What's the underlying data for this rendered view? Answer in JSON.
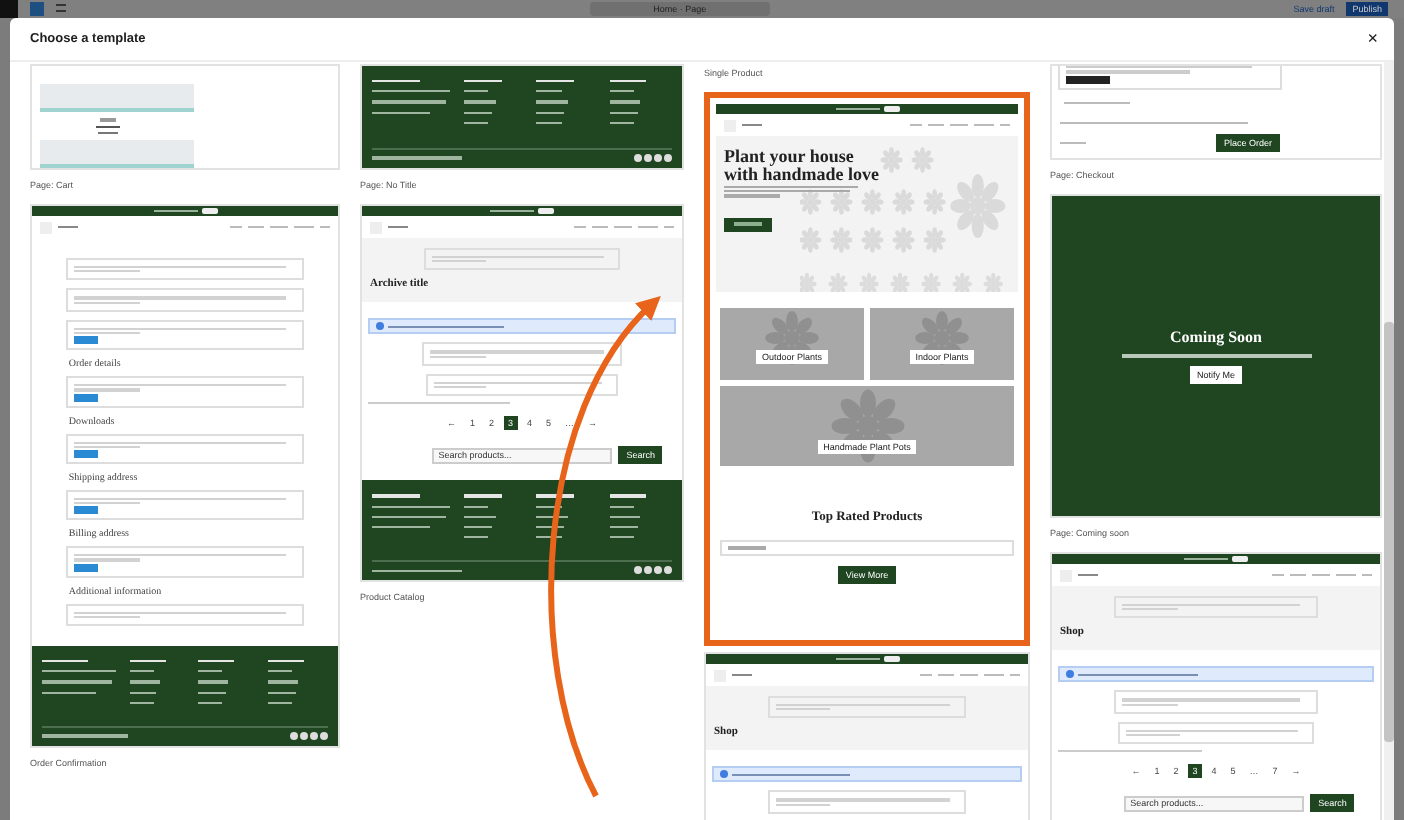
{
  "toolbar": {
    "document": "Home · Page",
    "save": "Save draft",
    "publish": "Publish"
  },
  "modal": {
    "title": "Choose a template",
    "close": "×"
  },
  "columns": [
    {
      "items": [
        {
          "kind": "cart",
          "label": "Page: Cart",
          "selected": false
        },
        {
          "kind": "order",
          "label": "Order Confirmation",
          "selected": false,
          "sections": [
            "Order details",
            "Downloads",
            "Shipping address",
            "Billing address",
            "Additional information"
          ]
        }
      ]
    },
    {
      "items": [
        {
          "kind": "footer",
          "label": "Page: No Title",
          "selected": false
        },
        {
          "kind": "archive",
          "label": "Product Catalog",
          "selected": false,
          "title": "Archive title",
          "pages": [
            {
              "label": "←",
              "selected": false
            },
            {
              "label": "1",
              "selected": false
            },
            {
              "label": "2",
              "selected": false
            },
            {
              "label": "3",
              "selected": true
            },
            {
              "label": "4",
              "selected": false
            },
            {
              "label": "5",
              "selected": false
            },
            {
              "label": "…",
              "selected": false
            },
            {
              "label": "→",
              "selected": false
            }
          ],
          "search": {
            "placeholder": "Search products...",
            "button": "Search"
          },
          "footer": true
        }
      ]
    },
    {
      "items": [
        {
          "kind": "caption",
          "label": "Single Product"
        },
        {
          "kind": "product",
          "selected": true,
          "headline": "Plant your house with handmade love",
          "tiles": [
            "Outdoor Plants",
            "Indoor Plants",
            "Handmade Plant Pots"
          ],
          "section_title": "Top Rated Products",
          "button": "View More"
        },
        {
          "kind": "archive",
          "selected": false,
          "title": "Shop"
        }
      ]
    },
    {
      "items": [
        {
          "kind": "checkout",
          "label": "Page: Checkout",
          "selected": false,
          "button": "Place Order"
        },
        {
          "kind": "coming",
          "label": "Page: Coming soon",
          "selected": false,
          "title": "Coming Soon",
          "button": "Notify Me"
        },
        {
          "kind": "archive",
          "selected": false,
          "title": "Shop",
          "pages": [
            {
              "label": "←",
              "selected": false
            },
            {
              "label": "1",
              "selected": false
            },
            {
              "label": "2",
              "selected": false
            },
            {
              "label": "3",
              "selected": true
            },
            {
              "label": "4",
              "selected": false
            },
            {
              "label": "5",
              "selected": false
            },
            {
              "label": "…",
              "selected": false
            },
            {
              "label": "7",
              "selected": false
            },
            {
              "label": "→",
              "selected": false
            }
          ],
          "search": {
            "placeholder": "Search products...",
            "button": "Search"
          }
        }
      ]
    }
  ]
}
